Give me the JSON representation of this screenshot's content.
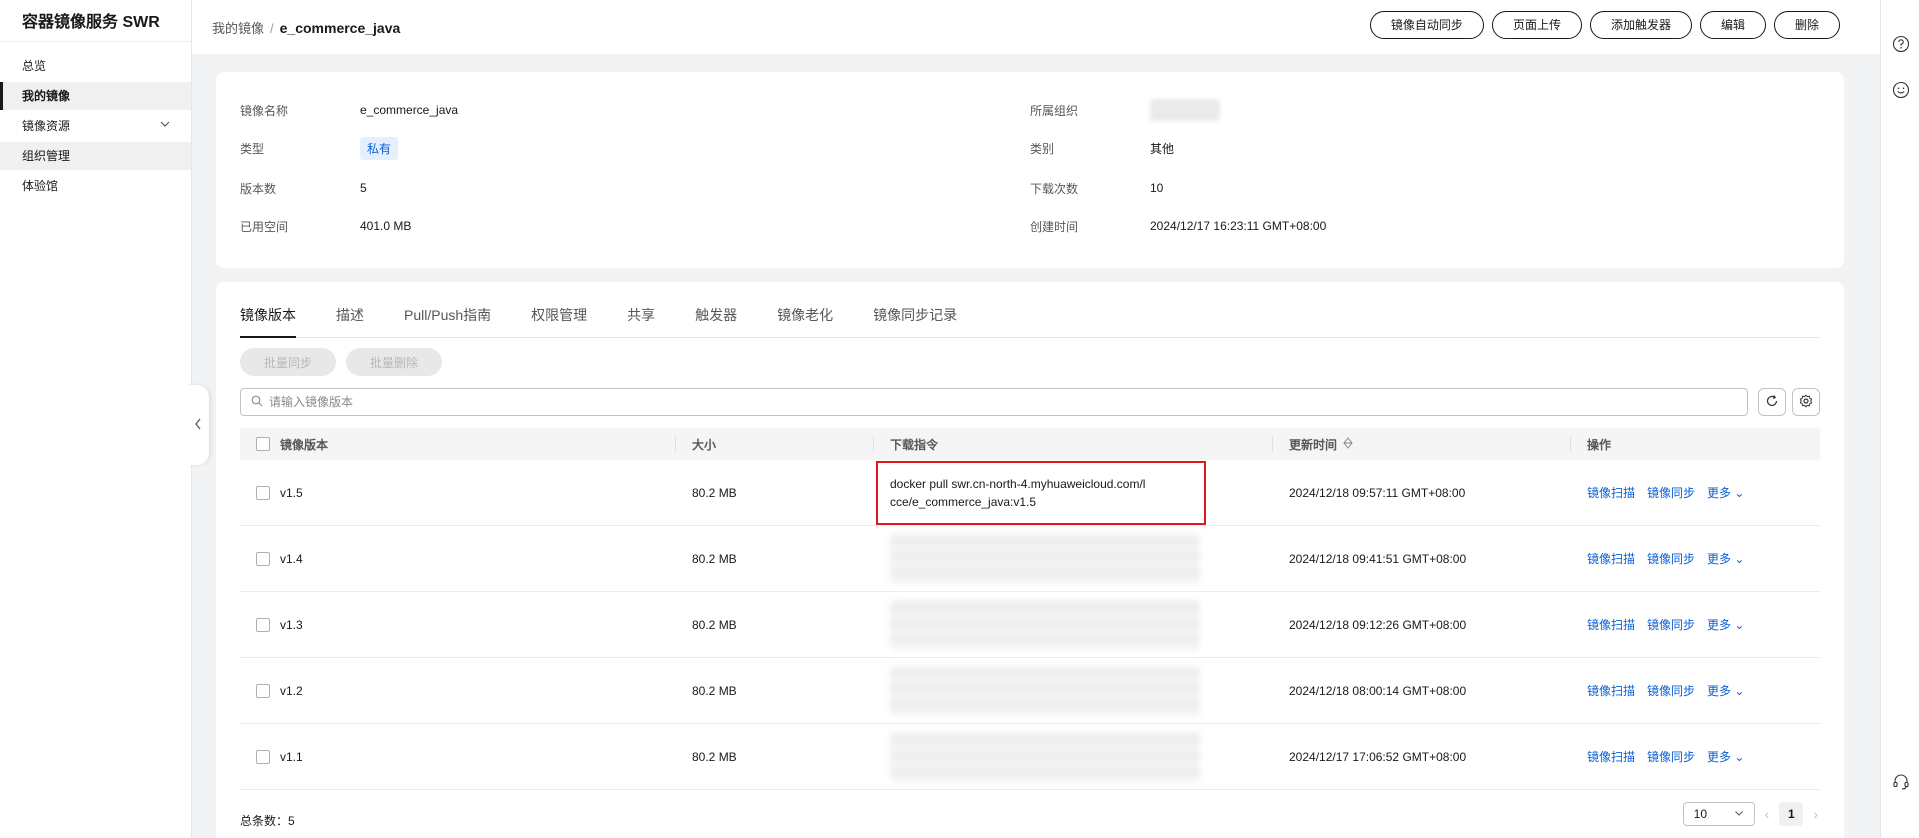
{
  "sidebar": {
    "title": "容器镜像服务 SWR",
    "items": [
      {
        "label": "总览"
      },
      {
        "label": "我的镜像"
      },
      {
        "label": "镜像资源"
      },
      {
        "label": "组织管理"
      },
      {
        "label": "体验馆"
      }
    ]
  },
  "breadcrumb": {
    "parent": "我的镜像",
    "separator": "/",
    "current": "e_commerce_java"
  },
  "header_actions": {
    "auto_sync": "镜像自动同步",
    "page_upload": "页面上传",
    "add_trigger": "添加触发器",
    "edit": "编辑",
    "delete": "删除"
  },
  "info": {
    "name_label": "镜像名称",
    "name_value": "e_commerce_java",
    "type_label": "类型",
    "type_value": "私有",
    "versions_label": "版本数",
    "versions_value": "5",
    "used_space_label": "已用空间",
    "used_space_value": "401.0 MB",
    "org_label": "所属组织",
    "category_label": "类别",
    "category_value": "其他",
    "downloads_label": "下载次数",
    "downloads_value": "10",
    "created_label": "创建时间",
    "created_value": "2024/12/17 16:23:11 GMT+08:00"
  },
  "tabs": [
    {
      "label": "镜像版本"
    },
    {
      "label": "描述"
    },
    {
      "label": "Pull/Push指南"
    },
    {
      "label": "权限管理"
    },
    {
      "label": "共享"
    },
    {
      "label": "触发器"
    },
    {
      "label": "镜像老化"
    },
    {
      "label": "镜像同步记录"
    }
  ],
  "batch": {
    "sync": "批量同步",
    "delete": "批量删除"
  },
  "search": {
    "placeholder": "请输入镜像版本"
  },
  "table": {
    "headers": {
      "version": "镜像版本",
      "size": "大小",
      "command": "下载指令",
      "updated": "更新时间",
      "actions": "操作"
    },
    "rows": [
      {
        "version": "v1.5",
        "size": "80.2 MB",
        "command_line1": "docker pull swr.cn-north-4.myhuaweicloud.com/l",
        "command_line2": "cce/e_commerce_java:v1.5",
        "updated": "2024/12/18 09:57:11 GMT+08:00"
      },
      {
        "version": "v1.4",
        "size": "80.2 MB",
        "updated": "2024/12/18 09:41:51 GMT+08:00"
      },
      {
        "version": "v1.3",
        "size": "80.2 MB",
        "updated": "2024/12/18 09:12:26 GMT+08:00"
      },
      {
        "version": "v1.2",
        "size": "80.2 MB",
        "updated": "2024/12/18 08:00:14 GMT+08:00"
      },
      {
        "version": "v1.1",
        "size": "80.2 MB",
        "updated": "2024/12/17 17:06:52 GMT+08:00"
      }
    ],
    "action_labels": {
      "scan": "镜像扫描",
      "sync": "镜像同步",
      "more": "更多"
    }
  },
  "footer": {
    "total_label": "总条数：",
    "total": "5",
    "page_size": "10",
    "current_page": "1"
  },
  "colors": {
    "accent": "#0a60d8",
    "highlight": "#e0191e",
    "tag_bg": "#e5f0ff"
  },
  "icons": [
    "search-icon",
    "refresh-icon",
    "settings-icon",
    "help-icon",
    "feedback-icon",
    "headset-icon",
    "chevron-down-icon",
    "chevron-left-icon",
    "sort-icon"
  ]
}
